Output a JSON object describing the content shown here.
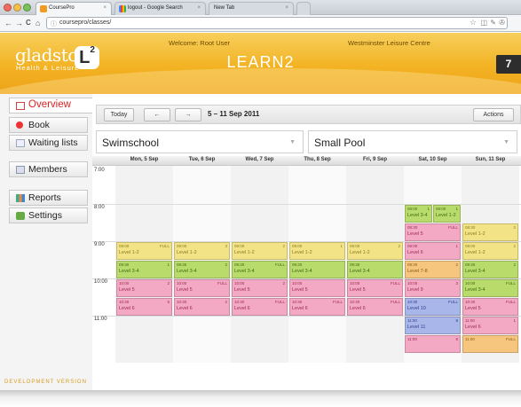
{
  "browser": {
    "tabs": [
      {
        "title": "CoursePro",
        "icon": "coursepro-favicon",
        "active": true
      },
      {
        "title": "logout - Google Search",
        "icon": "google-favicon",
        "active": false
      },
      {
        "title": "New Tab",
        "icon": "",
        "active": false
      }
    ],
    "close_glyph": "×",
    "url": "coursepro/classes/",
    "back_glyph": "←",
    "forward_glyph": "→",
    "reload_glyph": "C",
    "home_glyph": "⌂",
    "star_glyph": "☆",
    "ext_glyphs": [
      "◫",
      "✎",
      "✇"
    ]
  },
  "header": {
    "brand": "gladstone",
    "brand_logo_letter": "L",
    "brand_logo_sup": "2",
    "brand_sub": "Health & Leisure",
    "welcome": "Welcome: Root User",
    "centre": "Westminster Leisure Centre",
    "app_title": "LEARN2",
    "badge": "7",
    "colors": {
      "header": "#f3b323",
      "text": "#6b4a00"
    }
  },
  "sidebar": {
    "items": [
      {
        "label": "Overview",
        "icon": "calendar-icon",
        "active": true
      },
      {
        "label": "Book",
        "icon": "book-dot-icon",
        "active": false
      },
      {
        "label": "Waiting lists",
        "icon": "document-icon",
        "active": false
      },
      {
        "label": "Members",
        "icon": "members-icon",
        "active": false
      },
      {
        "label": "Reports",
        "icon": "chart-icon",
        "active": false
      },
      {
        "label": "Settings",
        "icon": "settings-icon",
        "active": false
      }
    ],
    "footer": "DEVELOPMENT VERSION"
  },
  "toolbar": {
    "today_label": "Today",
    "prev_label": "←",
    "next_label": "→",
    "range": "5 – 11 Sep 2011",
    "actions_label": "Actions"
  },
  "filters": {
    "programme": "Swimschool",
    "pool": "Small Pool",
    "caret": "▼"
  },
  "calendar": {
    "days": [
      "Mon, 5 Sep",
      "Tue, 6 Sep",
      "Wed, 7 Sep",
      "Thu, 8 Sep",
      "Fri, 9 Sep",
      "Sat, 10 Sep",
      "Sun, 11 Sep"
    ],
    "hours": [
      "7:00",
      "8:00",
      "9:00",
      "10:00",
      "11:00"
    ],
    "colors": {
      "yellow": "#f2e486",
      "green": "#b8db6c",
      "pink": "#f3a9c4",
      "blue": "#a9b6ea",
      "orange": "#f6c57e",
      "red": "#ef7a7a"
    },
    "events": [
      {
        "day": 5,
        "start": 8.0,
        "span": 0.5,
        "half": 0,
        "time": "08:00",
        "cap": "1",
        "level": "Level 3-4",
        "color": "green"
      },
      {
        "day": 5,
        "start": 8.0,
        "span": 0.5,
        "half": 1,
        "time": "08:00",
        "cap": "1",
        "level": "Level 1-2",
        "color": "green"
      },
      {
        "day": 5,
        "start": 8.5,
        "span": 0.5,
        "half": -1,
        "time": "08:30",
        "cap": "FULL",
        "level": "Level 5",
        "color": "pink"
      },
      {
        "day": 6,
        "start": 8.5,
        "span": 0.5,
        "half": -1,
        "time": "08:30",
        "cap": "2",
        "level": "Level 1-2",
        "color": "yellow"
      },
      {
        "day": 0,
        "start": 9.0,
        "span": 0.5,
        "half": -1,
        "time": "09:00",
        "cap": "FULL",
        "level": "Level 1-2",
        "color": "yellow"
      },
      {
        "day": 1,
        "start": 9.0,
        "span": 0.5,
        "half": -1,
        "time": "09:00",
        "cap": "3",
        "level": "Level 1-2",
        "color": "yellow"
      },
      {
        "day": 2,
        "start": 9.0,
        "span": 0.5,
        "half": -1,
        "time": "09:00",
        "cap": "2",
        "level": "Level 1-2",
        "color": "yellow"
      },
      {
        "day": 3,
        "start": 9.0,
        "span": 0.5,
        "half": -1,
        "time": "09:00",
        "cap": "1",
        "level": "Level 1-2",
        "color": "yellow"
      },
      {
        "day": 4,
        "start": 9.0,
        "span": 0.5,
        "half": -1,
        "time": "09:00",
        "cap": "2",
        "level": "Level 1-2",
        "color": "yellow"
      },
      {
        "day": 5,
        "start": 9.0,
        "span": 0.5,
        "half": -1,
        "time": "09:00",
        "cap": "1",
        "level": "Level 6",
        "color": "pink"
      },
      {
        "day": 6,
        "start": 9.0,
        "span": 0.5,
        "half": -1,
        "time": "09:00",
        "cap": "2",
        "level": "Level 1-2",
        "color": "yellow"
      },
      {
        "day": 0,
        "start": 9.5,
        "span": 0.5,
        "half": -1,
        "time": "09:30",
        "cap": "1",
        "level": "Level 3-4",
        "color": "green"
      },
      {
        "day": 1,
        "start": 9.5,
        "span": 0.5,
        "half": -1,
        "time": "09:30",
        "cap": "2",
        "level": "Level 3-4",
        "color": "green"
      },
      {
        "day": 2,
        "start": 9.5,
        "span": 0.5,
        "half": -1,
        "time": "09:30",
        "cap": "FULL",
        "level": "Level 3-4",
        "color": "green"
      },
      {
        "day": 3,
        "start": 9.5,
        "span": 0.5,
        "half": -1,
        "time": "09:30",
        "cap": "",
        "level": "Level 3-4",
        "color": "green"
      },
      {
        "day": 4,
        "start": 9.5,
        "span": 0.5,
        "half": -1,
        "time": "09:30",
        "cap": "",
        "level": "Level 3-4",
        "color": "green"
      },
      {
        "day": 5,
        "start": 9.5,
        "span": 0.5,
        "half": -1,
        "time": "09:30",
        "cap": "2",
        "level": "Level 7-8",
        "color": "orange"
      },
      {
        "day": 6,
        "start": 9.5,
        "span": 0.5,
        "half": -1,
        "time": "09:30",
        "cap": "2",
        "level": "Level 3-4",
        "color": "green"
      },
      {
        "day": 0,
        "start": 10.0,
        "span": 0.5,
        "half": -1,
        "time": "10:00",
        "cap": "2",
        "level": "Level 5",
        "color": "pink"
      },
      {
        "day": 1,
        "start": 10.0,
        "span": 0.5,
        "half": -1,
        "time": "10:00",
        "cap": "FULL",
        "level": "Level 5",
        "color": "pink"
      },
      {
        "day": 2,
        "start": 10.0,
        "span": 0.5,
        "half": -1,
        "time": "10:00",
        "cap": "2",
        "level": "Level 5",
        "color": "pink"
      },
      {
        "day": 3,
        "start": 10.0,
        "span": 0.5,
        "half": -1,
        "time": "10:00",
        "cap": "",
        "level": "Level 5",
        "color": "pink"
      },
      {
        "day": 4,
        "start": 10.0,
        "span": 0.5,
        "half": -1,
        "time": "10:00",
        "cap": "FULL",
        "level": "Level 5",
        "color": "pink"
      },
      {
        "day": 5,
        "start": 10.0,
        "span": 0.5,
        "half": -1,
        "time": "10:00",
        "cap": "3",
        "level": "Level 9",
        "color": "pink"
      },
      {
        "day": 6,
        "start": 10.0,
        "span": 0.5,
        "half": -1,
        "time": "10:00",
        "cap": "FULL",
        "level": "Level 3-4",
        "color": "green"
      },
      {
        "day": 0,
        "start": 10.5,
        "span": 0.5,
        "half": -1,
        "time": "10:30",
        "cap": "5",
        "level": "Level 6",
        "color": "pink"
      },
      {
        "day": 1,
        "start": 10.5,
        "span": 0.5,
        "half": -1,
        "time": "10:30",
        "cap": "2",
        "level": "Level 6",
        "color": "pink"
      },
      {
        "day": 2,
        "start": 10.5,
        "span": 0.5,
        "half": -1,
        "time": "10:30",
        "cap": "FULL",
        "level": "Level 6",
        "color": "pink"
      },
      {
        "day": 3,
        "start": 10.5,
        "span": 0.5,
        "half": -1,
        "time": "10:30",
        "cap": "FULL",
        "level": "Level 6",
        "color": "pink"
      },
      {
        "day": 4,
        "start": 10.5,
        "span": 0.5,
        "half": -1,
        "time": "10:30",
        "cap": "FULL",
        "level": "Level 6",
        "color": "pink"
      },
      {
        "day": 5,
        "start": 10.5,
        "span": 0.5,
        "half": -1,
        "time": "10:30",
        "cap": "FULL",
        "level": "Level 10",
        "color": "blue"
      },
      {
        "day": 6,
        "start": 10.5,
        "span": 0.5,
        "half": -1,
        "time": "10:30",
        "cap": "FULL",
        "level": "Level 5",
        "color": "pink"
      },
      {
        "day": 5,
        "start": 11.0,
        "span": 0.5,
        "half": -1,
        "time": "11:00",
        "cap": "8",
        "level": "Level 11",
        "color": "blue"
      },
      {
        "day": 6,
        "start": 11.0,
        "span": 0.5,
        "half": -1,
        "time": "11:00",
        "cap": "1",
        "level": "Level 6",
        "color": "pink"
      },
      {
        "day": 5,
        "start": 11.5,
        "span": 0.5,
        "half": -1,
        "time": "11:00",
        "cap": "8",
        "level": "",
        "color": "pink"
      },
      {
        "day": 6,
        "start": 11.5,
        "span": 0.5,
        "half": -1,
        "time": "11:00",
        "cap": "FULL",
        "level": "",
        "color": "orange"
      }
    ]
  }
}
